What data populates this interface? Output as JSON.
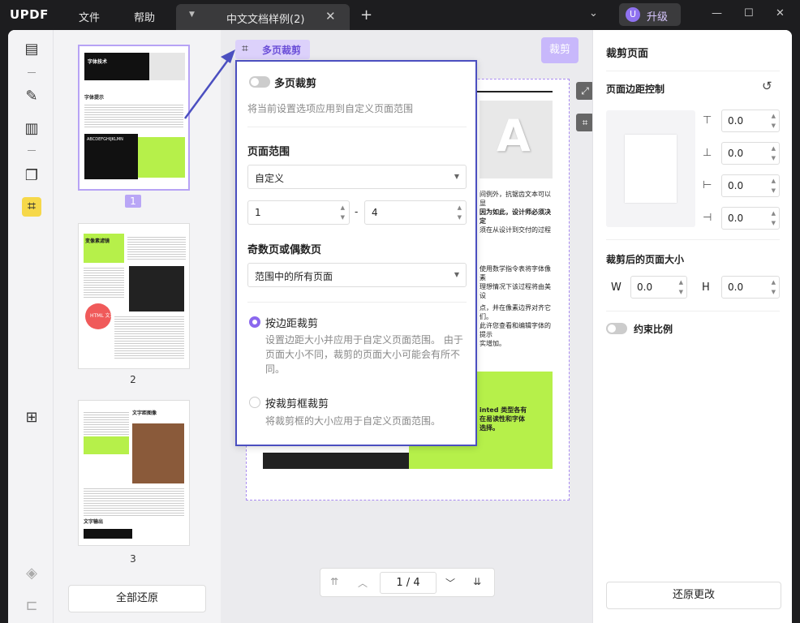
{
  "app": {
    "logo": "UPDF",
    "menu_file": "文件",
    "menu_help": "帮助",
    "tab_title": "中文文档样例(2)",
    "upgrade_avatar": "U",
    "upgrade_label": "升级"
  },
  "thumbnails": {
    "pages": [
      {
        "number": "1",
        "heading": "字体技术",
        "sub": "字体提示",
        "chars": "ABCDEFGHIJKLMN"
      },
      {
        "number": "2",
        "heading": "变像素滤镜",
        "sub": "HTML 文本"
      },
      {
        "number": "3",
        "heading": "文字距图像",
        "sub": "文字输出"
      }
    ],
    "restore_all": "全部还原"
  },
  "canvas": {
    "multi_crop_tag": "多页裁剪",
    "crop_button": "裁剪",
    "page_text_lines": [
      "间例外，抗锯齿文本可以显",
      "因为如此，设计师必须决定",
      "须在从设计到交付的过程",
      "使用数学指令表将字体像素",
      "理想情况下该过程将由美设",
      "点，并在像素边界对齐它们。",
      "此许您查看和编辑字体的提示",
      "实增加。",
      "inted 类型各有",
      "在易读性和字体",
      "选择。"
    ],
    "page_big_letter": "A",
    "pager": {
      "current": "1",
      "total": "4",
      "separator": "/"
    }
  },
  "popup": {
    "toggle_label": "多页裁剪",
    "toggle_desc": "将当前设置选项应用到自定义页面范围",
    "range_title": "页面范围",
    "range_value": "自定义",
    "range_from": "1",
    "range_dash": "-",
    "range_to": "4",
    "parity_title": "奇数页或偶数页",
    "parity_value": "范围中的所有页面",
    "opt1_label": "按边距裁剪",
    "opt1_desc": "设置边距大小并应用于自定义页面范围。 由于页面大小不同，裁剪的页面大小可能会有所不同。",
    "opt2_label": "按裁剪框裁剪",
    "opt2_desc": "将裁剪框的大小应用于自定义页面范围。"
  },
  "right_panel": {
    "title": "裁剪页面",
    "margin_title": "页面边距控制",
    "margins": {
      "top": "0.0",
      "bottom": "0.0",
      "left": "0.0",
      "right": "0.0"
    },
    "size_title": "裁剪后的页面大小",
    "w_label": "W",
    "w_value": "0.0",
    "h_label": "H",
    "h_value": "0.0",
    "constrain_label": "约束比例",
    "restore_button": "还原更改"
  },
  "colors": {
    "accent": "#8b68ee",
    "accent_light": "#c8b8fb",
    "popup_border": "#4b4fc0",
    "lime": "#b6f04a"
  }
}
